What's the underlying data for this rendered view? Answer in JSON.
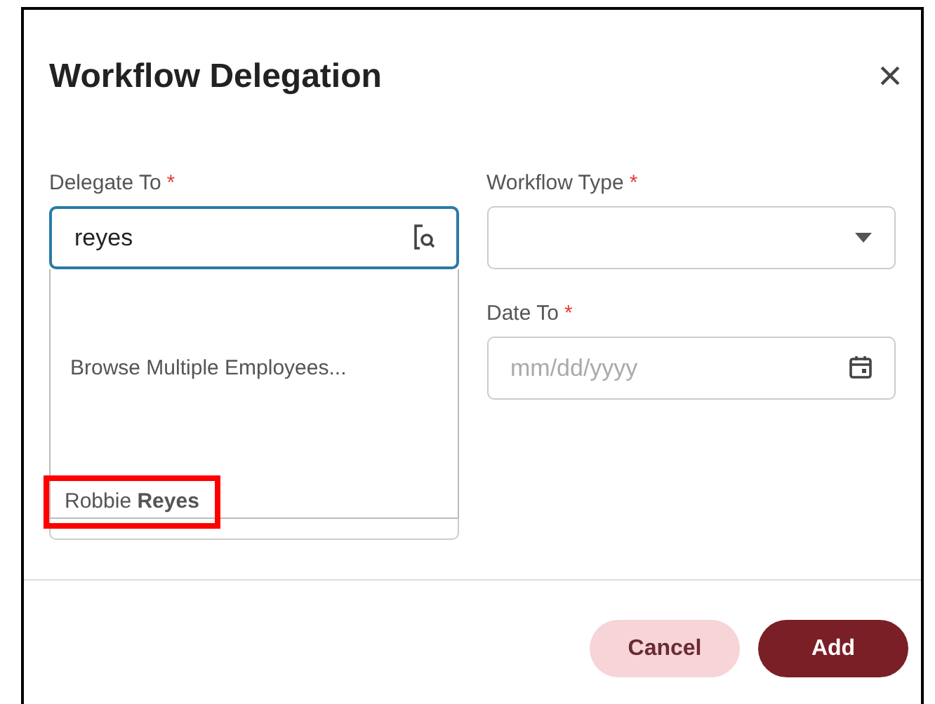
{
  "dialog": {
    "title": "Workflow Delegation",
    "close": "×"
  },
  "delegate_to": {
    "label": "Delegate To",
    "required": "*",
    "value": "reyes",
    "options": [
      {
        "text": "Browse Multiple Employees...",
        "highlighted": false
      },
      {
        "text": "Robbie **Reyes**",
        "highlighted": true
      }
    ]
  },
  "workflow_type": {
    "label": "Workflow Type",
    "required": "*"
  },
  "date_to": {
    "label": "Date To",
    "required": "*",
    "placeholder": "mm/dd/yyyy"
  },
  "buttons": [
    {
      "label": "Cancel",
      "kind": "secondary"
    },
    {
      "label": "Add",
      "kind": "primary"
    }
  ]
}
